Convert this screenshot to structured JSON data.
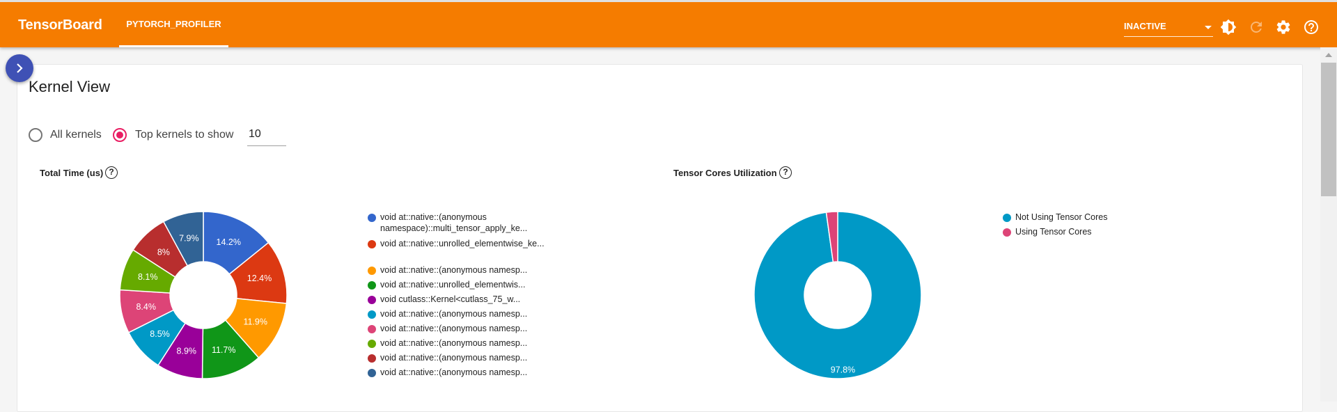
{
  "header": {
    "brand": "TensorBoard",
    "active_tab": "PYTORCH_PROFILER",
    "run_select": "INACTIVE",
    "icons": [
      "theme-toggle-icon",
      "reload-icon",
      "settings-icon",
      "help-icon"
    ],
    "colors": {
      "bar": "#f57c00",
      "fab": "#3f51b5",
      "radio_accent": "#e91e63"
    }
  },
  "kernel_view": {
    "title": "Kernel View",
    "radio_all": "All kernels",
    "radio_top": "Top kernels to show",
    "top_value": "10",
    "selected": "top"
  },
  "chart_data": [
    {
      "type": "pie",
      "title": "Total Time (us)",
      "donut": true,
      "legend_position": "right",
      "series": [
        {
          "name": "void at::native::(anonymous namespace)::multi_tensor_apply_ke...",
          "value": 14.2,
          "label": "14.2%",
          "color": "#3366cc"
        },
        {
          "name": "void at::native::unrolled_elementwise_ke...",
          "value": 12.4,
          "label": "12.4%",
          "color": "#dc3912"
        },
        {
          "name": "void at::native::(anonymous namesp...",
          "value": 11.9,
          "label": "11.9%",
          "color": "#ff9900"
        },
        {
          "name": "void at::native::unrolled_elementwis...",
          "value": 11.7,
          "label": "11.7%",
          "color": "#109618"
        },
        {
          "name": "void cutlass::Kernel<cutlass_75_w...",
          "value": 8.9,
          "label": "8.9%",
          "color": "#990099"
        },
        {
          "name": "void at::native::(anonymous namesp...",
          "value": 8.5,
          "label": "8.5%",
          "color": "#0099c6"
        },
        {
          "name": "void at::native::(anonymous namesp...",
          "value": 8.4,
          "label": "8.4%",
          "color": "#dd4477"
        },
        {
          "name": "void at::native::(anonymous namesp...",
          "value": 8.1,
          "label": "8.1%",
          "color": "#66aa00"
        },
        {
          "name": "void at::native::(anonymous namesp...",
          "value": 8.0,
          "label": "8%",
          "color": "#b82e2e"
        },
        {
          "name": "void at::native::(anonymous namesp...",
          "value": 7.9,
          "label": "7.9%",
          "color": "#316395"
        }
      ]
    },
    {
      "type": "pie",
      "title": "Tensor Cores Utilization",
      "donut": true,
      "legend_position": "right",
      "series": [
        {
          "name": "Not Using Tensor Cores",
          "value": 97.8,
          "label": "97.8%",
          "color": "#0099c6"
        },
        {
          "name": "Using Tensor Cores",
          "value": 2.2,
          "label": "",
          "color": "#dd4477"
        }
      ]
    }
  ]
}
